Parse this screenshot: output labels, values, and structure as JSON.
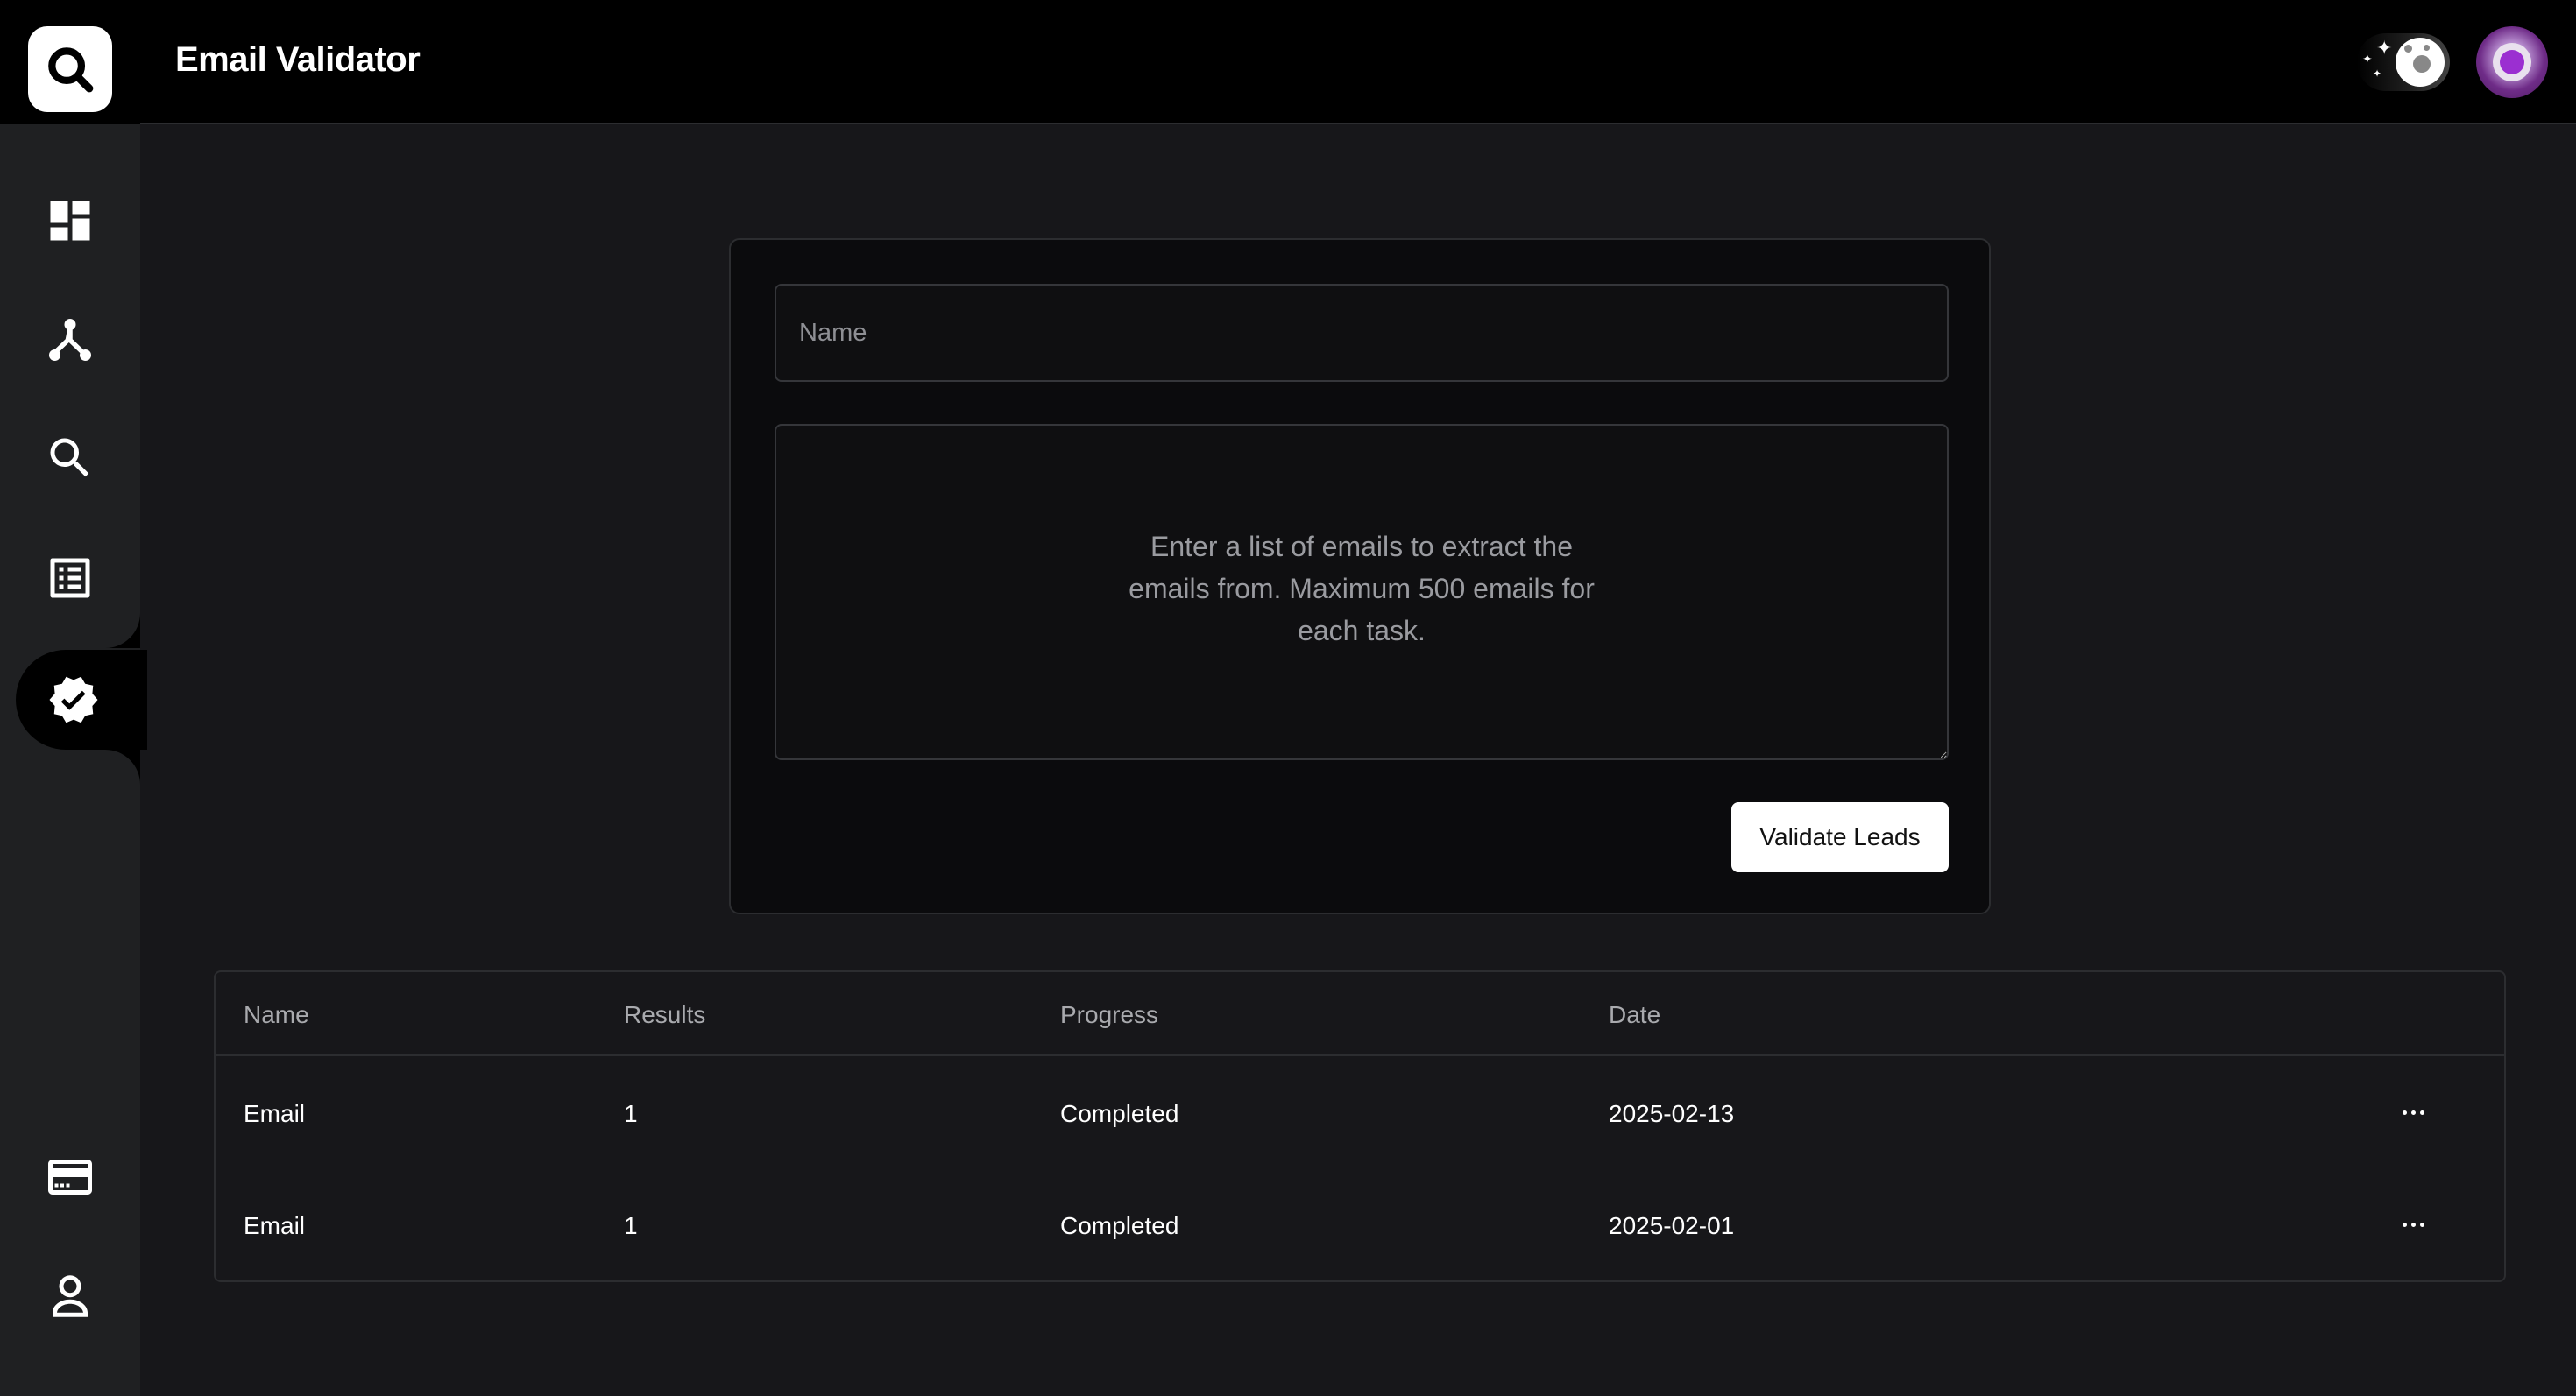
{
  "app": {
    "title": "Email Validator"
  },
  "sidebar": {
    "items": [
      {
        "icon": "dashboard-icon"
      },
      {
        "icon": "workflow-icon"
      },
      {
        "icon": "search-icon"
      },
      {
        "icon": "list-icon"
      },
      {
        "icon": "verified-badge-icon",
        "active": true
      },
      {
        "icon": "credit-card-icon"
      },
      {
        "icon": "user-icon"
      }
    ]
  },
  "header": {
    "theme_toggle_icon": "moon-icon",
    "avatar_icon": "astronaut-avatar"
  },
  "form": {
    "name_placeholder": "Name",
    "emails_placeholder": "Enter a list of emails to extract the emails from. Maximum 500 emails for each task.",
    "submit_label": "Validate Leads"
  },
  "table": {
    "columns": [
      "Name",
      "Results",
      "Progress",
      "Date"
    ],
    "rows": [
      {
        "name": "Email",
        "results": "1",
        "progress": "Completed",
        "date": "2025-02-13"
      },
      {
        "name": "Email",
        "results": "1",
        "progress": "Completed",
        "date": "2025-02-01"
      }
    ]
  },
  "colors": {
    "background": "#17171a",
    "sidebar": "#1f2022",
    "header": "#000000",
    "card": "#0b0b0d",
    "accent_avatar": "#9b2fd1"
  }
}
